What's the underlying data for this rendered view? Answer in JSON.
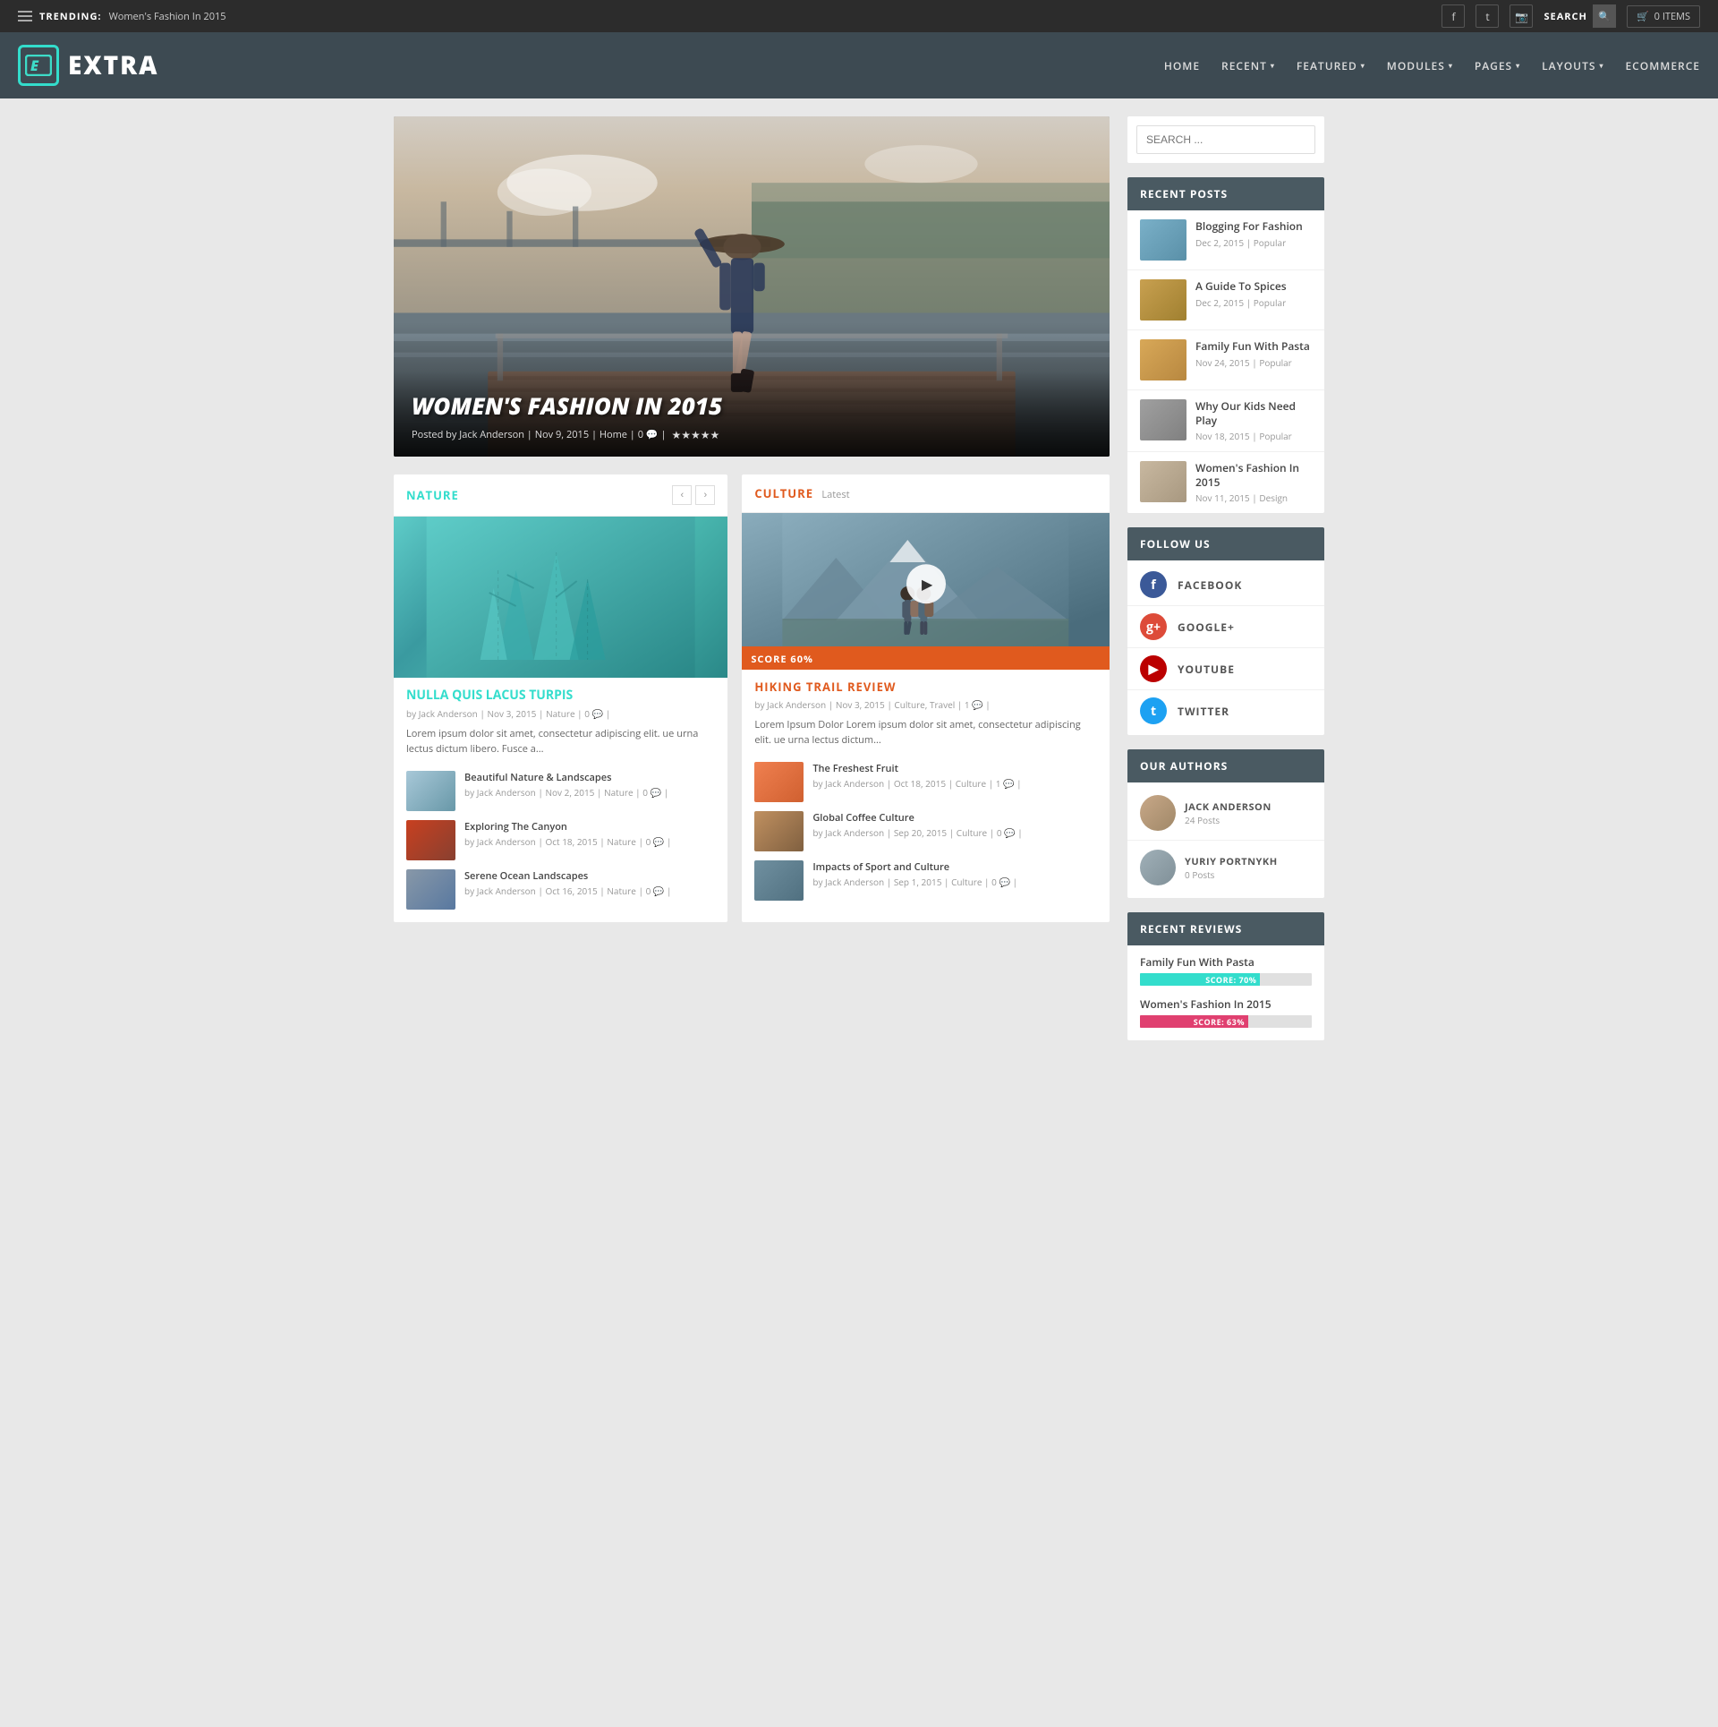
{
  "topbar": {
    "trending_label": "TRENDING:",
    "trending_value": "Women's Fashion In 2015",
    "search_label": "SEARCH",
    "cart_label": "0 ITEMS"
  },
  "header": {
    "logo_text": "EXTRA",
    "nav": [
      {
        "label": "HOME",
        "has_arrow": false
      },
      {
        "label": "RECENT",
        "has_arrow": true
      },
      {
        "label": "FEATURED",
        "has_arrow": true
      },
      {
        "label": "MODULES",
        "has_arrow": true
      },
      {
        "label": "PAGES",
        "has_arrow": true
      },
      {
        "label": "LAYOUTS",
        "has_arrow": true
      },
      {
        "label": "ECOMMERCE",
        "has_arrow": false
      }
    ]
  },
  "hero": {
    "title": "WOMEN'S FASHION IN 2015",
    "meta": "Posted by Jack Anderson | Nov 9, 2015 | Home | 0 💬 |"
  },
  "nature_panel": {
    "title": "NATURE",
    "featured_title": "NULLA QUIS LACUS TURPIS",
    "featured_meta": "by Jack Anderson | Nov 3, 2015 | Nature | 0 💬 |",
    "featured_excerpt": "Lorem ipsum dolor sit amet, consectetur adipiscing elit. ue urna lectus dictum libero. Fusce a...",
    "items": [
      {
        "title": "Beautiful Nature & Landscapes",
        "meta": "by Jack Anderson | Nov 2, 2015 | Nature | 0 💬 |",
        "thumb": "bt"
      },
      {
        "title": "Exploring The Canyon",
        "meta": "by Jack Anderson | Oct 18, 2015 | Nature | 0 💬 |",
        "thumb": "canyon"
      },
      {
        "title": "Serene Ocean Landscapes",
        "meta": "by Jack Anderson | Oct 16, 2015 | Nature | 0 💬 |",
        "thumb": "ocean"
      }
    ]
  },
  "culture_panel": {
    "title": "CULTURE",
    "subtitle": "Latest",
    "featured_score": "SCORE 60%",
    "featured_title": "HIKING TRAIL REVIEW",
    "featured_meta": "by Jack Anderson | Nov 3, 2015 | Culture, Travel | 1 💬 |",
    "featured_excerpt": "Lorem Ipsum Dolor Lorem ipsum dolor sit amet, consectetur adipiscing elit. ue urna lectus dictum...",
    "items": [
      {
        "title": "The Freshest Fruit",
        "meta": "by Jack Anderson | Oct 18, 2015 | Culture | 1 💬 |",
        "thumb": "fruit"
      },
      {
        "title": "Global Coffee Culture",
        "meta": "by Jack Anderson | Sep 20, 2015 | Culture | 0 💬 |",
        "thumb": "coffee"
      },
      {
        "title": "Impacts of Sport and Culture",
        "meta": "by Jack Anderson | Sep 1, 2015 | Culture | 0 💬 |",
        "thumb": "sport"
      }
    ]
  },
  "sidebar": {
    "search_placeholder": "SEARCH ...",
    "recent_posts_title": "RECENT POSTS",
    "recent_posts": [
      {
        "title": "Blogging For Fashion",
        "meta": "Dec 2, 2015 | Popular",
        "thumb": "fashion"
      },
      {
        "title": "A Guide To Spices",
        "meta": "Dec 2, 2015 | Popular",
        "thumb": "spices"
      },
      {
        "title": "Family Fun With Pasta",
        "meta": "Nov 24, 2015 | Popular",
        "thumb": "pasta"
      },
      {
        "title": "Why Our Kids Need Play",
        "meta": "Nov 18, 2015 | Popular",
        "thumb": "play"
      },
      {
        "title": "Women's Fashion In 2015",
        "meta": "Nov 11, 2015 | Design",
        "thumb": "wfashion"
      }
    ],
    "follow_title": "FOLLOW US",
    "follow_items": [
      {
        "label": "FACEBOOK",
        "type": "fb"
      },
      {
        "label": "GOOGLE+",
        "type": "gp"
      },
      {
        "label": "YOUTUBE",
        "type": "yt"
      },
      {
        "label": "TWITTER",
        "type": "tw"
      }
    ],
    "authors_title": "OUR AUTHORS",
    "authors": [
      {
        "name": "JACK ANDERSON",
        "posts": "24 Posts",
        "av": "av1"
      },
      {
        "name": "YURIY PORTNYKH",
        "posts": "0 Posts",
        "av": "av2"
      }
    ],
    "reviews_title": "RECENT REVIEWS",
    "reviews": [
      {
        "title": "Family Fun With Pasta",
        "score": "SCORE: 70%",
        "pct": 70,
        "color": "rb-green"
      },
      {
        "title": "Women's Fashion In 2015",
        "score": "SCORE: 63%",
        "pct": 63,
        "color": "rb-pink"
      }
    ]
  }
}
